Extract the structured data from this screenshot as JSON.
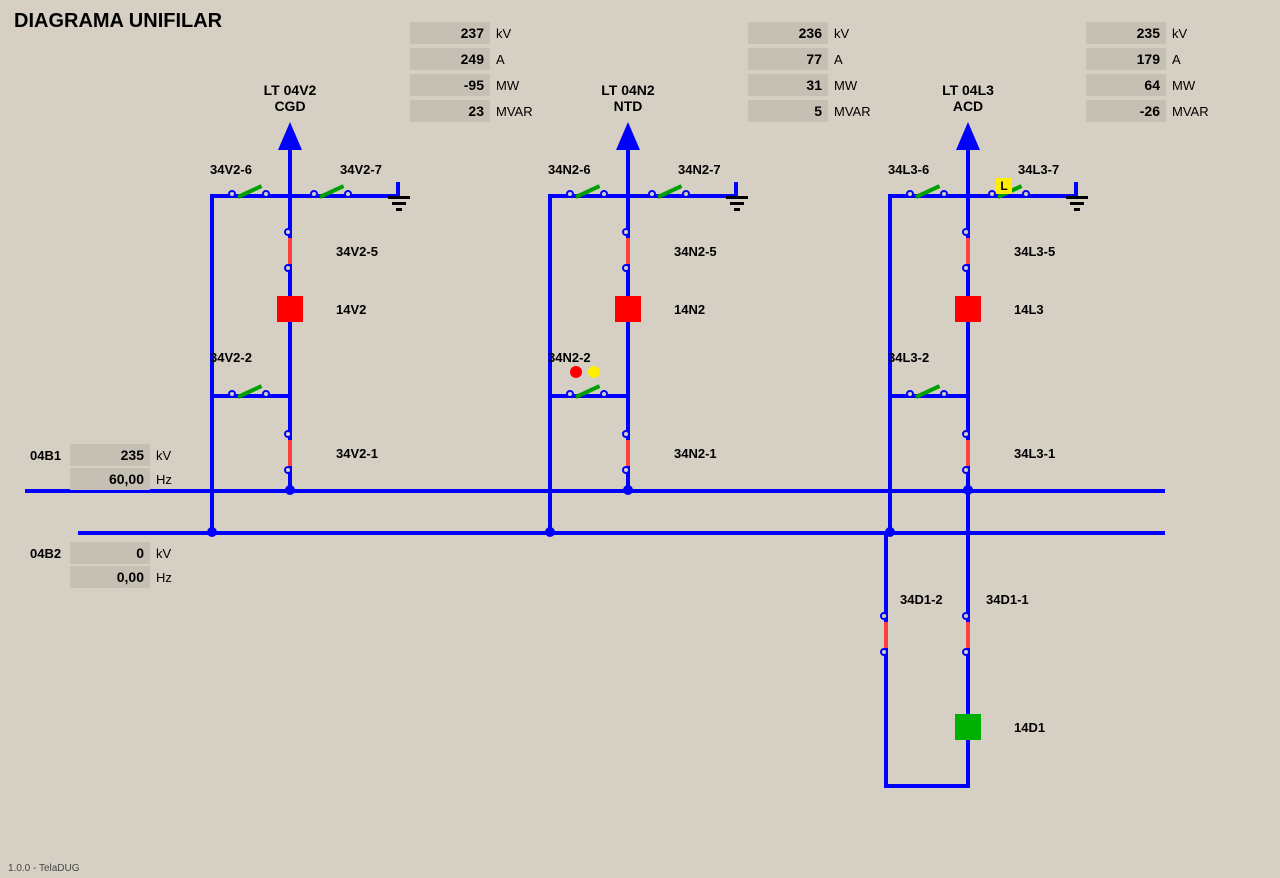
{
  "title": "DIAGRAMA UNIFILAR",
  "footer": "1.0.0 - TelaDUG",
  "bays": {
    "v2": {
      "header1": "LT 04V2",
      "header2": "CGD",
      "kv": "237",
      "a": "249",
      "mw": "-95",
      "mvar": "23",
      "sw_top_l": "34V2-6",
      "sw_top_r": "34V2-7",
      "sw_5": "34V2-5",
      "brk": "14V2",
      "sw_2": "34V2-2",
      "sw_1": "34V2-1"
    },
    "n2": {
      "header1": "LT 04N2",
      "header2": "NTD",
      "kv": "236",
      "a": "77",
      "mw": "31",
      "mvar": "5",
      "sw_top_l": "34N2-6",
      "sw_top_r": "34N2-7",
      "sw_5": "34N2-5",
      "brk": "14N2",
      "sw_2": "34N2-2",
      "sw_1": "34N2-1"
    },
    "l3": {
      "header1": "LT 04L3",
      "header2": "ACD",
      "kv": "235",
      "a": "179",
      "mw": "64",
      "mvar": "-26",
      "sw_top_l": "34L3-6",
      "sw_top_r": "34L3-7",
      "sw_5": "34L3-5",
      "brk": "14L3",
      "sw_2": "34L3-2",
      "sw_1": "34L3-1",
      "lbadge": "L"
    },
    "d1": {
      "sw_2": "34D1-2",
      "sw_1": "34D1-1",
      "brk": "14D1"
    }
  },
  "buses": {
    "b1": {
      "name": "04B1",
      "kv": "235",
      "hz": "60,00"
    },
    "b2": {
      "name": "04B2",
      "kv": "0",
      "hz": "0,00"
    }
  },
  "units": {
    "kv": "kV",
    "a": "A",
    "mw": "MW",
    "mvar": "MVAR",
    "hz": "Hz"
  }
}
